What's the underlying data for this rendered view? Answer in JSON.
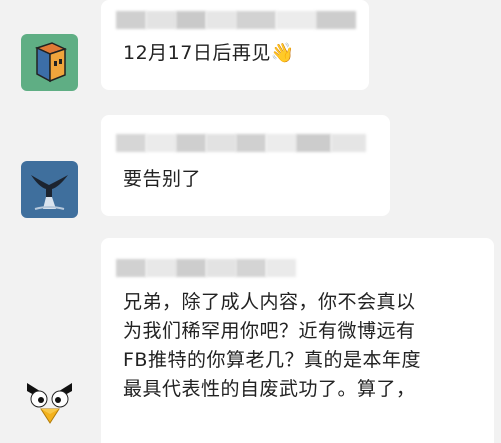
{
  "messages": [
    {
      "avatar": "cube-avatar",
      "text": "12月17日后再见👋"
    },
    {
      "avatar": "bird-avatar",
      "text": "要告别了"
    },
    {
      "avatar": "angry-bird-avatar",
      "text": "兄弟，除了成人内容，你不会真以\n为我们稀罕用你吧？近有微博远有\nFB推特的你算老几？真的是本年度\n最具代表性的自废武功了。算了，"
    }
  ],
  "colors": {
    "background": "#f2f2f2",
    "bubble": "#ffffff",
    "text": "#222222"
  }
}
